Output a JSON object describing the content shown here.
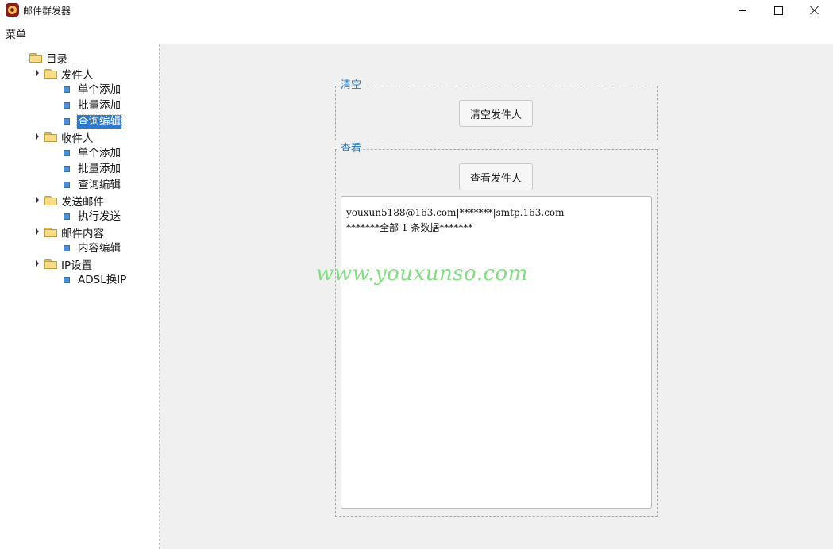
{
  "window": {
    "title": "邮件群发器",
    "icon": "app-logo-icon"
  },
  "menubar": {
    "menu_label": "菜单"
  },
  "tree": {
    "root_label": "目录",
    "groups": [
      {
        "label": "发件人",
        "children": [
          "单个添加",
          "批量添加",
          "查询编辑"
        ]
      },
      {
        "label": "收件人",
        "children": [
          "单个添加",
          "批量添加",
          "查询编辑"
        ]
      },
      {
        "label": "发送邮件",
        "children": [
          "执行发送"
        ]
      },
      {
        "label": "邮件内容",
        "children": [
          "内容编辑"
        ]
      },
      {
        "label": "IP设置",
        "children": [
          "ADSL换IP"
        ]
      }
    ],
    "selected": "发件人 / 查询编辑"
  },
  "clear_group": {
    "legend": "清空",
    "button_label": "清空发件人"
  },
  "view_group": {
    "legend": "查看",
    "button_label": "查看发件人",
    "output_lines": [
      "youxun5188@163.com|*******|smtp.163.com",
      "*******全部 1 条数据*******"
    ]
  },
  "watermark": "www.youxunso.com",
  "colors": {
    "legend_text": "#2a78b5",
    "selected_item_bg": "#2f7ad1",
    "watermark": "#7fe07f"
  }
}
